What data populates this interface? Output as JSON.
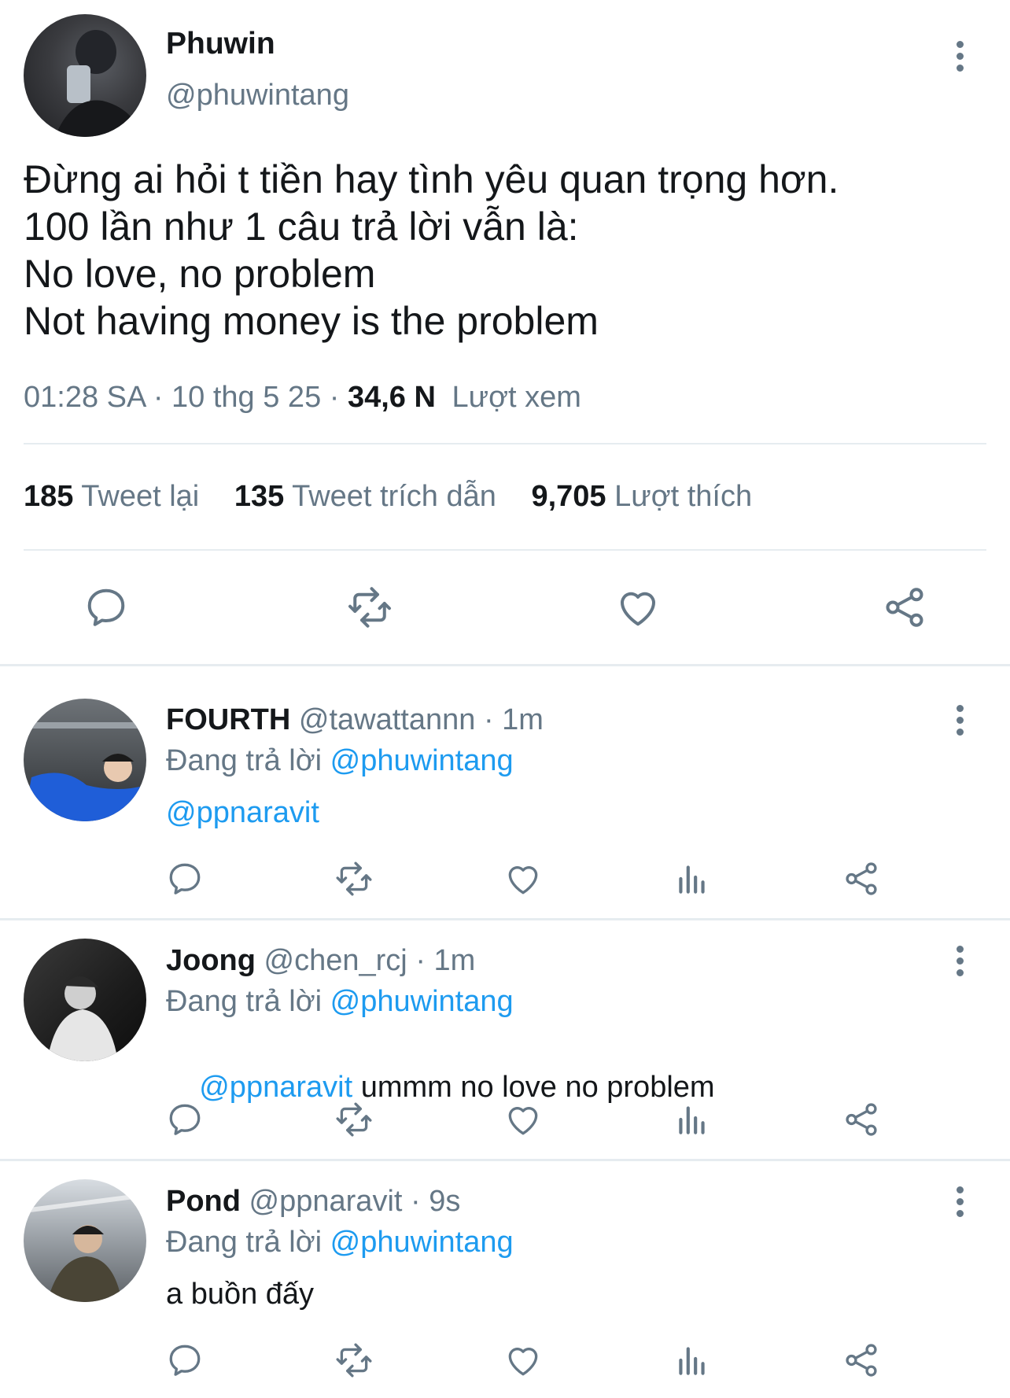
{
  "main_tweet": {
    "name": "Phuwin",
    "handle": "@phuwintang",
    "lines": [
      "Đừng ai hỏi t tiền hay tình yêu quan trọng hơn.",
      "100 lần như 1 câu trả lời vẫn là:",
      "No love, no problem",
      "Not having money is the problem"
    ],
    "time": "01:28 SA",
    "date": "10 thg 5 25",
    "views_count": "34,6 N",
    "views_label": "Lượt xem",
    "retweets_count": "185",
    "retweets_label": "Tweet lại",
    "quotes_count": "135",
    "quotes_label": "Tweet trích dẫn",
    "likes_count": "9,705",
    "likes_label": "Lượt thích"
  },
  "replying_prefix": "Đang trả lời",
  "replies": [
    {
      "name": "FOURTH",
      "handle": "@tawattannn",
      "time": "1m",
      "replying_to": "@phuwintang",
      "mention": "@ppnaravit",
      "text": ""
    },
    {
      "name": "Joong",
      "handle": "@chen_rcj",
      "time": "1m",
      "replying_to": "@phuwintang",
      "mention": "@ppnaravit",
      "text": " ummm no love no problem"
    },
    {
      "name": "Pond",
      "handle": "@ppnaravit",
      "time": "9s",
      "replying_to": "@phuwintang",
      "mention": "",
      "text": "a buồn đấy"
    }
  ],
  "separator": "·",
  "colors": {
    "accent": "#1d9bf0",
    "muted": "#657786",
    "divider": "#e6ecf0"
  },
  "icons": [
    "reply-icon",
    "retweet-icon",
    "like-icon",
    "views-icon",
    "share-icon",
    "more-icon"
  ]
}
